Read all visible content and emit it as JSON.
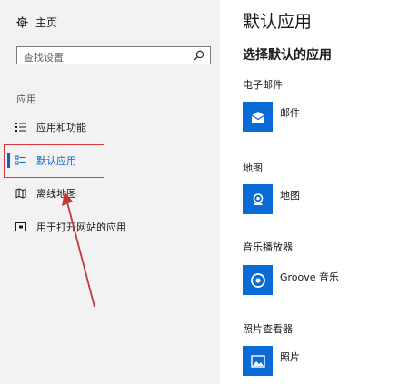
{
  "sidebar": {
    "home_label": "主页",
    "search": {
      "placeholder": "查找设置",
      "value": ""
    },
    "section_label": "应用",
    "items": [
      {
        "label": "应用和功能",
        "icon": "list-icon"
      },
      {
        "label": "默认应用",
        "icon": "default-apps-icon",
        "selected": true
      },
      {
        "label": "离线地图",
        "icon": "offline-map-icon"
      },
      {
        "label": "用于打开网站的应用",
        "icon": "open-website-icon"
      }
    ]
  },
  "main": {
    "title": "默认应用",
    "subtitle": "选择默认的应用",
    "categories": [
      {
        "label": "电子邮件",
        "app": "邮件",
        "icon": "mail-icon"
      },
      {
        "label": "地图",
        "app": "地图",
        "icon": "map-icon"
      },
      {
        "label": "音乐播放器",
        "app": "Groove 音乐",
        "icon": "groove-music-icon"
      },
      {
        "label": "照片查看器",
        "app": "照片",
        "icon": "photos-icon"
      }
    ]
  },
  "colors": {
    "accent": "#0a63c9",
    "tile": "#0a6ad6",
    "annotation": "#d9373f",
    "sidebar_bg": "#f2f2f2"
  }
}
